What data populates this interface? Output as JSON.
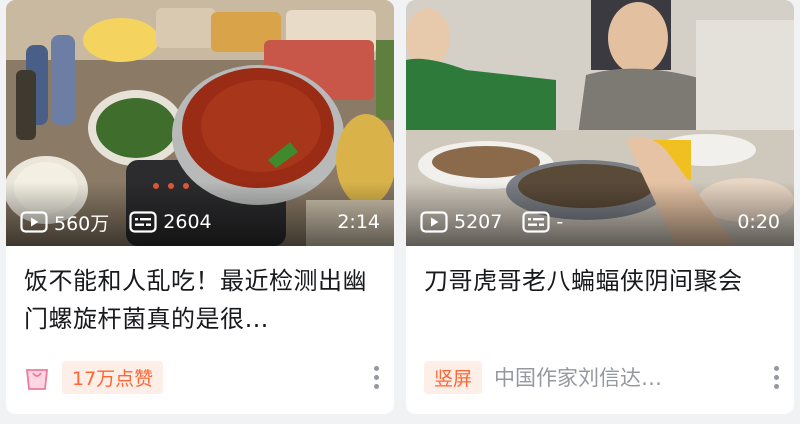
{
  "cards": [
    {
      "plays": "560万",
      "danmaku": "2604",
      "duration": "2:14",
      "title": "饭不能和人乱吃！最近检测出幽门螺旋杆菌真的是很…",
      "badge": "17万点赞",
      "badge_icon": "shopping-bag-icon"
    },
    {
      "plays": "5207",
      "danmaku": "-",
      "duration": "0:20",
      "title": "刀哥虎哥老八蝙蝠侠阴间聚会",
      "badge": "竖屏",
      "author": "中国作家刘信达…"
    }
  ],
  "colors": {
    "badge_text": "#ff6633",
    "badge_bg": "#fdeee8",
    "meta_text": "#9499a0",
    "title_text": "#18191c"
  }
}
